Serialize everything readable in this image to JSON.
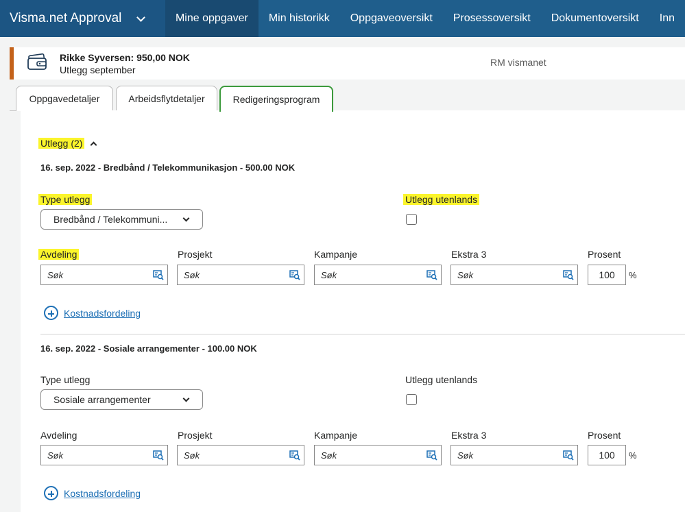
{
  "app": {
    "title": "Visma.net Approval"
  },
  "nav": {
    "items": [
      {
        "label": "Mine oppgaver",
        "active": true
      },
      {
        "label": "Min historikk",
        "active": false
      },
      {
        "label": "Oppgaveoversikt",
        "active": false
      },
      {
        "label": "Prosessoversikt",
        "active": false
      },
      {
        "label": "Dokumentoversikt",
        "active": false
      },
      {
        "label": "Inn",
        "active": false
      }
    ]
  },
  "task": {
    "title": "Rikke Syversen: 950,00 NOK",
    "subtitle": "Utlegg september",
    "org": "RM vismanet",
    "icon": "wallet-icon",
    "accent_color": "#c4621a"
  },
  "tabs": [
    {
      "label": "Oppgavedetaljer",
      "active": false
    },
    {
      "label": "Arbeidsflytdetaljer",
      "active": false
    },
    {
      "label": "Redigeringsprogram",
      "active": true
    }
  ],
  "section": {
    "label": "Utlegg (2)",
    "expanded": true
  },
  "expenses": [
    {
      "title": "16. sep. 2022 - Bredbånd / Telekommunikasjon - 500.00 NOK",
      "type_label": "Type utlegg",
      "type_value": "Bredbånd / Telekommuni...",
      "abroad_label": "Utlegg utenlands",
      "abroad_checked": false,
      "fields": [
        {
          "label": "Avdeling",
          "placeholder": "Søk"
        },
        {
          "label": "Prosjekt",
          "placeholder": "Søk"
        },
        {
          "label": "Kampanje",
          "placeholder": "Søk"
        },
        {
          "label": "Ekstra 3",
          "placeholder": "Søk"
        }
      ],
      "percent_label": "Prosent",
      "percent_value": "100",
      "percent_sign": "%",
      "link_label": "Kostnadsfordeling"
    },
    {
      "title": "16. sep. 2022 - Sosiale arrangementer - 100.00 NOK",
      "type_label": "Type utlegg",
      "type_value": "Sosiale arrangementer",
      "abroad_label": "Utlegg utenlands",
      "abroad_checked": false,
      "fields": [
        {
          "label": "Avdeling",
          "placeholder": "Søk"
        },
        {
          "label": "Prosjekt",
          "placeholder": "Søk"
        },
        {
          "label": "Kampanje",
          "placeholder": "Søk"
        },
        {
          "label": "Ekstra 3",
          "placeholder": "Søk"
        }
      ],
      "percent_label": "Prosent",
      "percent_value": "100",
      "percent_sign": "%",
      "link_label": "Kostnadsfordeling"
    }
  ],
  "highlight_color": "#fbf52c",
  "link_color": "#1c6fb5"
}
